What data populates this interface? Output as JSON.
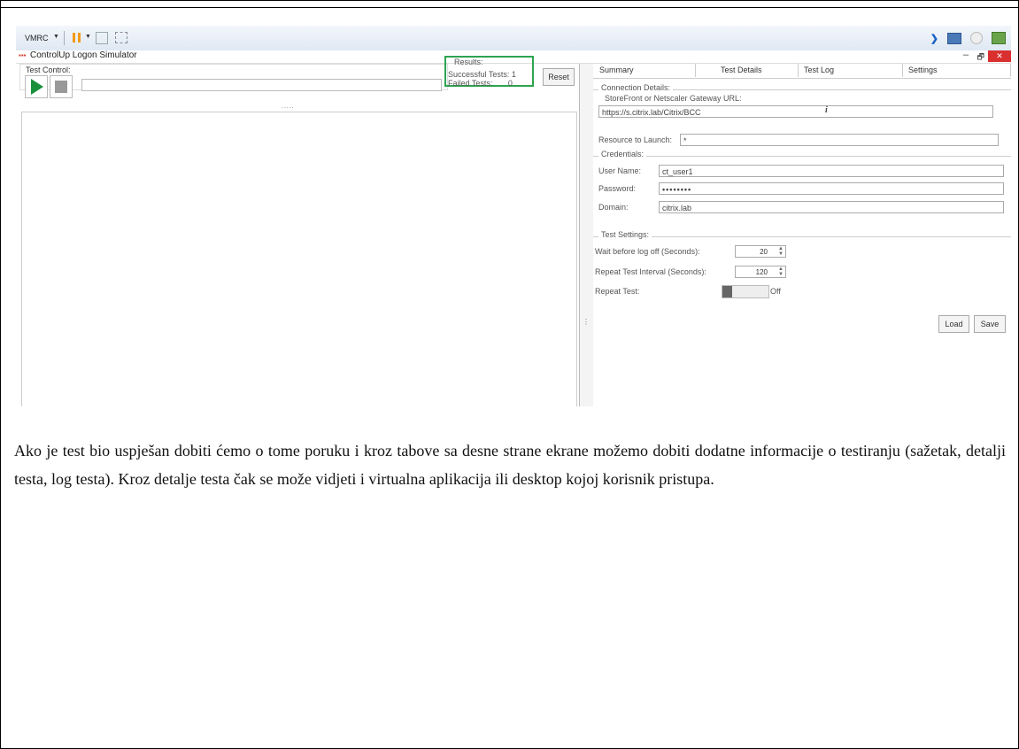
{
  "screenshot": {
    "toolbar": {
      "vmrc_label": "VMRC"
    },
    "window": {
      "title": "ControlUp Logon Simulator",
      "minimize": "–",
      "restore": "🗗",
      "close": "✕"
    },
    "test_control": {
      "label": "Test Control:",
      "results_label": "Results:",
      "successful_tests": "Successful Tests:  1",
      "failed_tests": "Failed Tests:       0",
      "reset_label": "Reset",
      "splitter": "....."
    },
    "tabs": [
      "Summary",
      "Test Details",
      "Test Log",
      "Settings"
    ],
    "settings": {
      "connection_details": "Connection Details:",
      "gateway_label": "StoreFront or Netscaler Gateway URL:",
      "gateway_url": "https://s.citrix.lab/Citrix/BCC",
      "info_glyph": "i",
      "resource_label": "Resource to Launch:",
      "resource_value": "*",
      "credentials": "Credentials:",
      "user_label": "User Name:",
      "user_value": "ct_user1",
      "password_label": "Password:",
      "password_value": "••••••••",
      "domain_label": "Domain:",
      "domain_value": "citrix.lab",
      "test_settings": "Test Settings:",
      "wait_label": "Wait before log off (Seconds):",
      "wait_value": "20",
      "interval_label": "Repeat Test Interval (Seconds):",
      "interval_value": "120",
      "repeat_label": "Repeat Test:",
      "repeat_state": "Off",
      "load_label": "Load",
      "save_label": "Save"
    }
  },
  "paragraph": "Ako je test bio uspješan dobiti ćemo o tome poruku i kroz tabove sa desne strane ekrane možemo dobiti dodatne informacije o testiranju (sažetak, detalji testa, log testa). Kroz detalje testa čak se može vidjeti i virtualna aplikacija ili desktop kojoj korisnik pristupa."
}
